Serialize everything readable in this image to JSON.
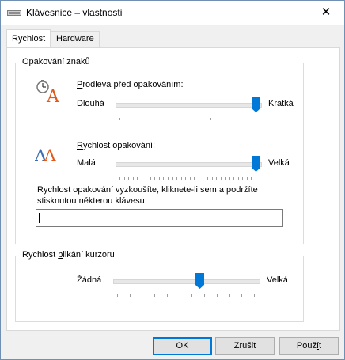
{
  "window": {
    "title": "Klávesnice – vlastnosti",
    "close_glyph": "✕"
  },
  "tabs": [
    {
      "label": "Rychlost",
      "active": true
    },
    {
      "label": "Hardware",
      "active": false
    }
  ],
  "repeat_group": {
    "legend": "Opakování znaků",
    "delay": {
      "label_first": "P",
      "label_rest": "rodleva před opakováním:",
      "min_label": "Dlouhá",
      "max_label": "Krátká",
      "value": 3,
      "min": 0,
      "max": 3
    },
    "rate": {
      "label_first": "R",
      "label_rest": "ychlost opakování:",
      "min_label": "Malá",
      "max_label": "Velká",
      "value": 31,
      "min": 0,
      "max": 31
    },
    "test_instructions_line1": "Rychlost opakování vyzkoušíte, kliknete-li sem a podržíte",
    "test_instructions_line2": "stisknutou některou klávesu:",
    "test_value": ""
  },
  "cursor_group": {
    "legend_prefix": "Rychlost ",
    "legend_underlined": "b",
    "legend_suffix": "likání kurzoru",
    "min_label": "Žádná",
    "max_label": "Velká",
    "value": 12,
    "min": 0,
    "max": 20
  },
  "buttons": {
    "ok": "OK",
    "cancel": "Zrušit",
    "apply_prefix": "Použ",
    "apply_underlined": "í",
    "apply_suffix": "t"
  },
  "colors": {
    "accent": "#0078d7",
    "icon_orange": "#e05a1a",
    "icon_blue": "#3a6db5"
  }
}
